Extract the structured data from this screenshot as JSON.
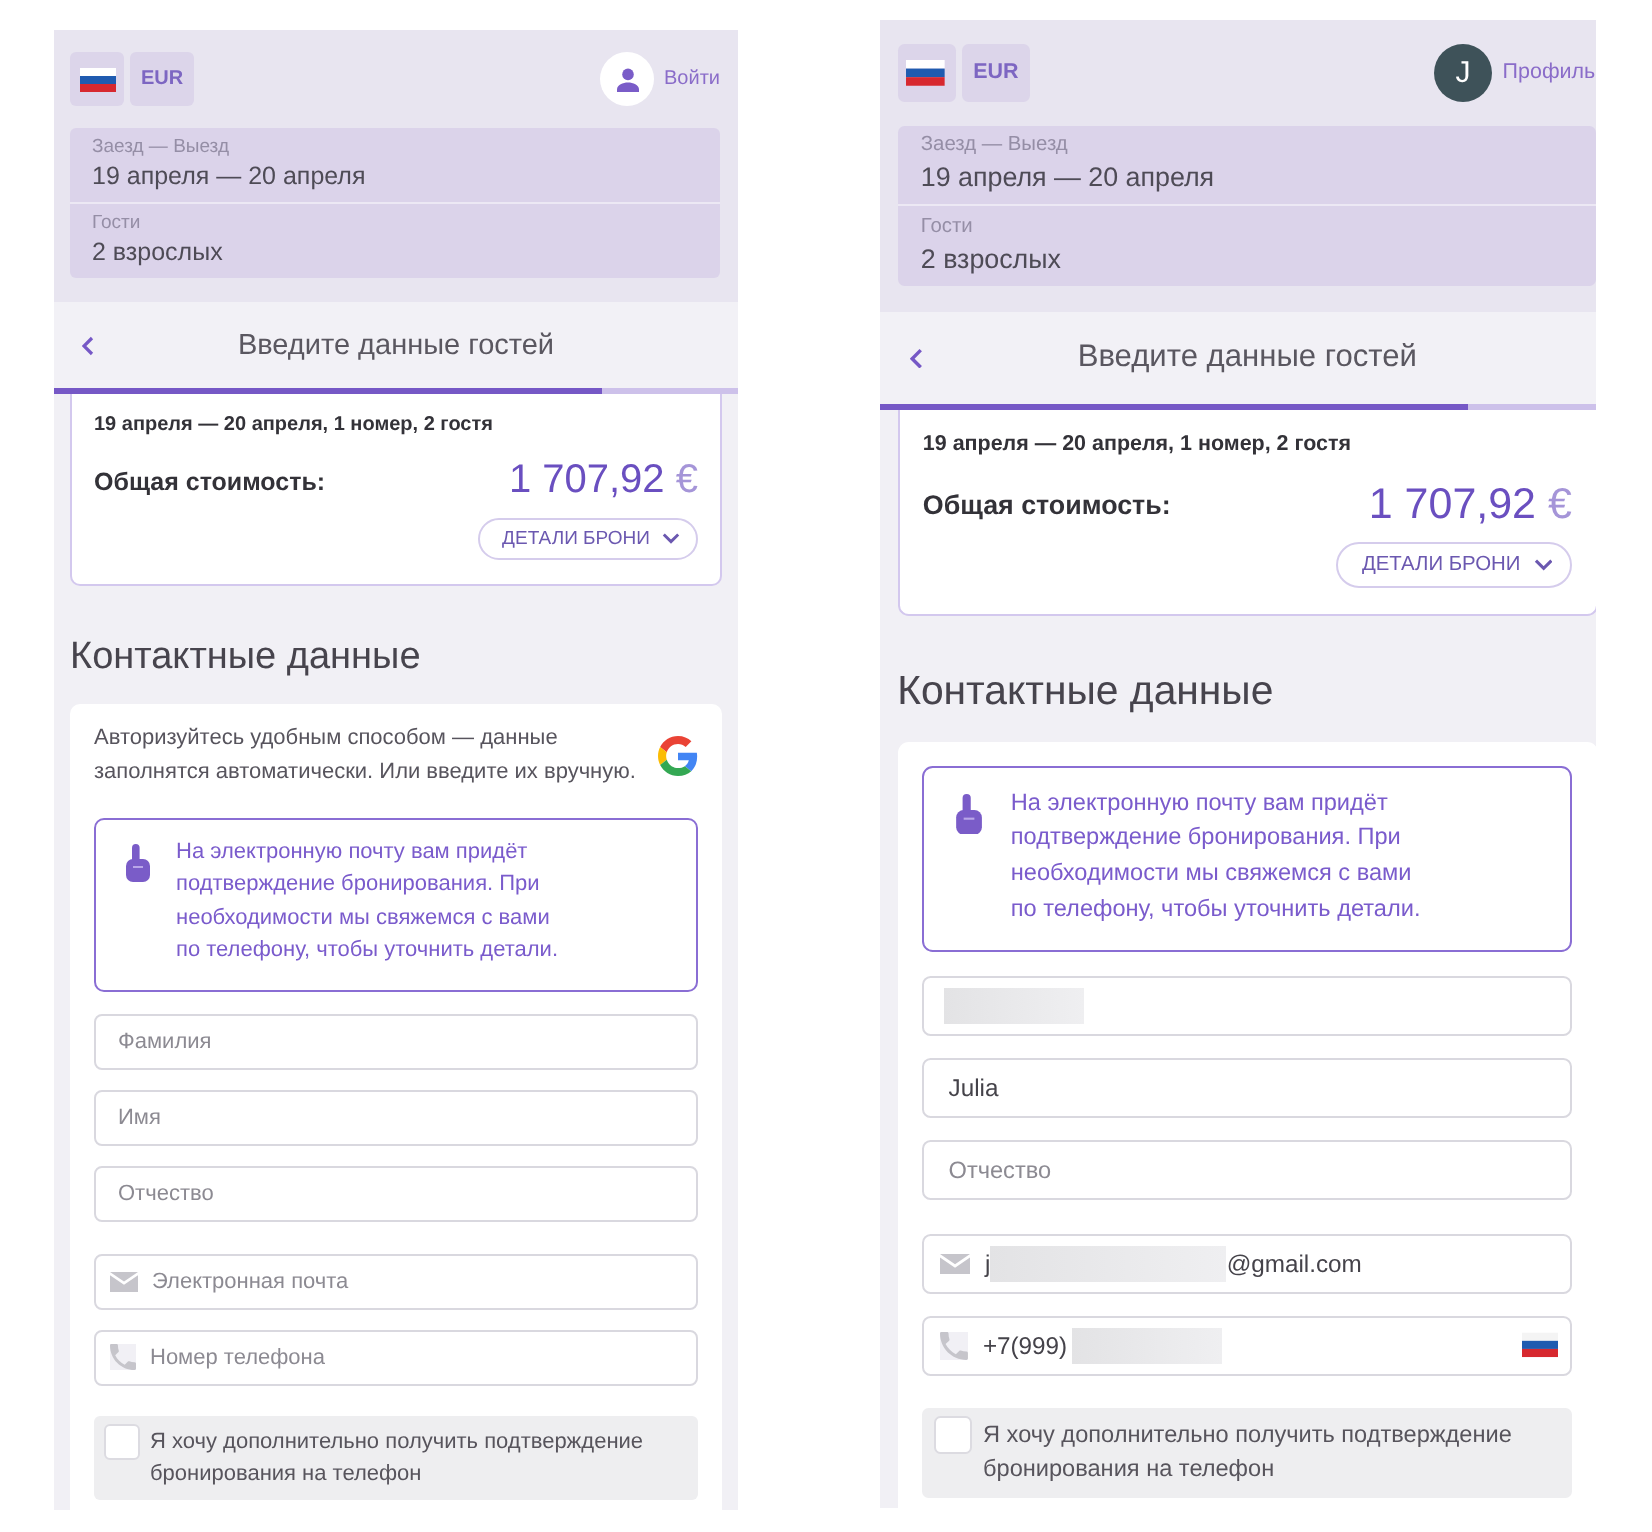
{
  "screens": [
    {
      "header": {
        "currency": "EUR",
        "account": {
          "label": "Войти"
        }
      },
      "search": [
        {
          "label": "Заезд — Выезд",
          "value": "19 апреля — 20 апреля"
        },
        {
          "label": "Гости",
          "value": "2 взрослых"
        }
      ],
      "nav": {
        "title": "Введите данные гостей",
        "progress": {
          "level": 0.8
        }
      },
      "summary": {
        "dates": "19 апреля — 20 апреля, 1 номер, 2 гостя",
        "total_label": "Общая стоимость:",
        "price": "1 707,92",
        "currency_sign": "€",
        "details_button": "ДЕТАЛИ БРОНИ"
      },
      "contact": {
        "heading": "Контактные данные",
        "auth_hint": "Авторизуйтесь удобным способом — данные заполнятся автоматически. Или введите их вручную.",
        "notice": "На электронную почту вам придёт подтверждение бронирования. При необходимости мы свяжемся с вами по телефону, чтобы уточнить детали.",
        "fields": [
          {
            "kind": "text",
            "placeholder": "Фамилия"
          },
          {
            "kind": "text",
            "placeholder": "Имя"
          },
          {
            "kind": "text",
            "placeholder": "Отчество"
          },
          {
            "kind": "email",
            "placeholder": "Электронная почта"
          },
          {
            "kind": "phone",
            "placeholder": "Номер телефона"
          }
        ],
        "sms_option": {
          "label": "Я хочу дополнительно получить подтверждение бронирования на телефон",
          "checked": false
        }
      }
    },
    {
      "header": {
        "currency": "EUR",
        "account": {
          "initial": "J",
          "label": "Профиль"
        }
      },
      "search": [
        {
          "label": "Заезд — Выезд",
          "value": "19 апреля — 20 апреля"
        },
        {
          "label": "Гости",
          "value": "2 взрослых"
        }
      ],
      "nav": {
        "title": "Введите данные гостей",
        "progress": {
          "level": 0.8
        }
      },
      "summary": {
        "dates": "19 апреля — 20 апреля, 1 номер, 2 гостя",
        "total_label": "Общая стоимость:",
        "price": "1 707,92",
        "currency_sign": "€",
        "details_button": "ДЕТАЛИ БРОНИ"
      },
      "contact": {
        "heading": "Контактные данные",
        "notice": "На электронную почту вам придёт подтверждение бронирования. При необходимости мы свяжемся с вами по телефону, чтобы уточнить детали.",
        "fields": [
          {
            "kind": "text",
            "redacted": true
          },
          {
            "kind": "text",
            "value": "Julia"
          },
          {
            "kind": "text",
            "placeholder": "Отчество"
          },
          {
            "kind": "email",
            "value": "j",
            "redacted": true,
            "value_after": "@gmail.com"
          },
          {
            "kind": "phone",
            "value": "+7(999)",
            "redacted": true,
            "country_flag": true
          }
        ],
        "sms_option": {
          "label": "Я хочу дополнительно получить подтверждение бронирования на телефон",
          "checked": false
        }
      }
    }
  ]
}
